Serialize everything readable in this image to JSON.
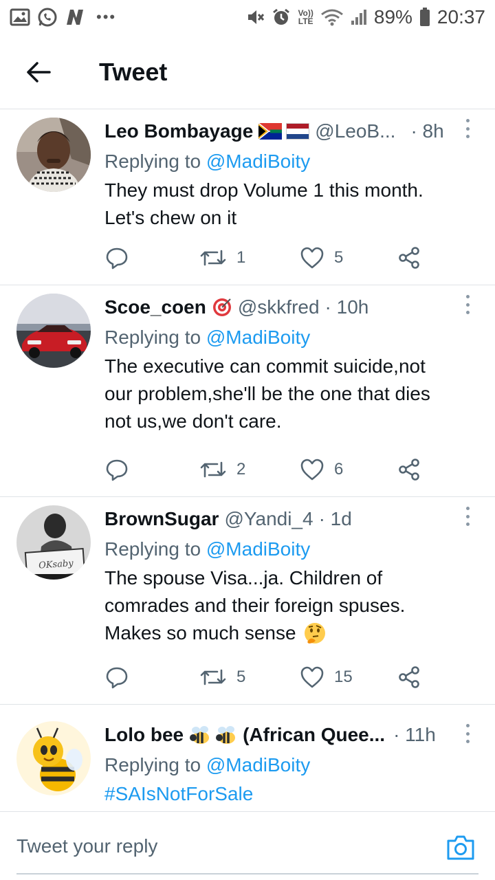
{
  "status_bar": {
    "battery": "89%",
    "time": "20:37",
    "lte_top": "Vo))",
    "lte_bottom": "LTE",
    "dots": "•••"
  },
  "header": {
    "title": "Tweet"
  },
  "tweets": [
    {
      "name": "Leo Bombayage",
      "handle": "@LeoB...",
      "time": "· 8h",
      "replying_prefix": "Replying to ",
      "replying_to": "@MadiBoity",
      "text_lines": [
        "They must drop Volume 1 this month.",
        "Let's chew on it"
      ],
      "retweets": "1",
      "likes": "5"
    },
    {
      "name": "Scoe_coen",
      "handle": "@skkfred",
      "time": "· 10h",
      "replying_prefix": "Replying to ",
      "replying_to": "@MadiBoity",
      "text_lines": [
        "The executive can commit suicide,not",
        "our problem,she'll be the one that dies",
        "not us,we don't care."
      ],
      "retweets": "2",
      "likes": "6"
    },
    {
      "name": "BrownSugar",
      "handle": "@Yandi_4",
      "time": "· 1d",
      "replying_prefix": "Replying to ",
      "replying_to": "@MadiBoity",
      "text_lines": [
        "The spouse Visa...ja. Children of",
        "comrades and their foreign spuses.",
        "Makes so much sense"
      ],
      "retweets": "5",
      "likes": "15"
    },
    {
      "name": "Lolo bee",
      "name_suffix": "(African Quee...",
      "time": "· 11h",
      "replying_prefix": "Replying to ",
      "replying_to": "@MadiBoity",
      "text_lines": [
        "#SAIsNotForSale"
      ]
    }
  ],
  "avatar_texts": {
    "brownsugar_sign": "OKsaby"
  },
  "reply_bar": {
    "placeholder": "Tweet your reply"
  },
  "colors": {
    "accent": "#1d9bf0",
    "secondary_text": "#536471",
    "divider": "#dfe3e7"
  },
  "icons": [
    "image-icon",
    "whatsapp-icon",
    "n-app-icon",
    "mute-icon",
    "alarm-icon",
    "wifi-icon",
    "signal-icon",
    "battery-icon",
    "back-arrow-icon",
    "more-icon",
    "reply-icon",
    "retweet-icon",
    "like-icon",
    "share-icon",
    "camera-icon"
  ]
}
